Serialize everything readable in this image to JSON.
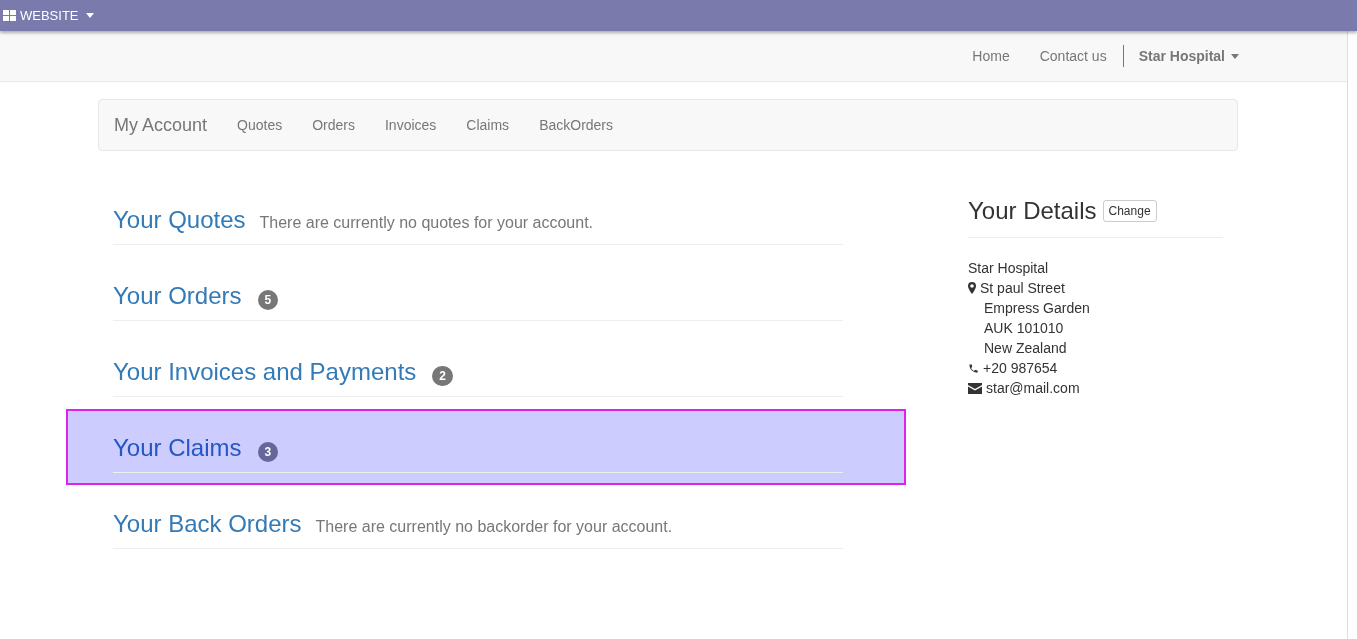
{
  "top_bar": {
    "menu": "WEBSITE"
  },
  "navbar": {
    "links": [
      "Home",
      "Contact us"
    ],
    "user": "Star Hospital"
  },
  "account_nav": {
    "title": "My Account",
    "links": [
      "Quotes",
      "Orders",
      "Invoices",
      "Claims",
      "BackOrders"
    ]
  },
  "sections": [
    {
      "title": "Your Quotes",
      "note": "There are currently no quotes for your account.",
      "highlighted": false
    },
    {
      "title": "Your Orders",
      "count": "5",
      "highlighted": false
    },
    {
      "title": "Your Invoices and Payments",
      "count": "2",
      "highlighted": false
    },
    {
      "title": "Your Claims",
      "count": "3",
      "highlighted": true
    },
    {
      "title": "Your Back Orders",
      "note": "There are currently no backorder for your account.",
      "highlighted": false
    }
  ],
  "details": {
    "title": "Your Details",
    "button": "Change",
    "name": "Star Hospital",
    "address": [
      "St paul Street",
      "Empress Garden",
      "AUK 101010",
      "New Zealand"
    ],
    "phone": "+20 987654",
    "email": "star@mail.com"
  }
}
